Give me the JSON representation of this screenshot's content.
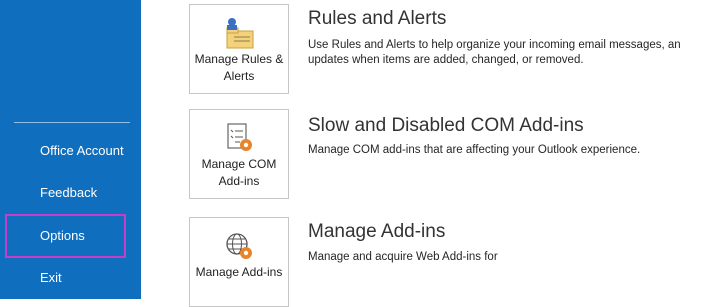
{
  "sidebar": {
    "items": [
      {
        "label": "Office Account"
      },
      {
        "label": "Feedback"
      },
      {
        "label": "Options"
      },
      {
        "label": "Exit"
      }
    ]
  },
  "sections": [
    {
      "button_label": "Manage Rules & Alerts",
      "icon": "rules-alerts-icon",
      "title": "Rules and Alerts",
      "desc_line1": "Use Rules and Alerts to help organize your incoming email messages, an",
      "desc_line2": "updates when items are added, changed, or removed."
    },
    {
      "button_label": "Manage COM Add-ins",
      "icon": "com-addins-icon",
      "title": "Slow and Disabled COM Add-ins",
      "desc_line1": "Manage COM add-ins that are affecting your Outlook experience."
    },
    {
      "button_label": "Manage Add-ins",
      "icon": "globe-gear-icon",
      "title": "Manage Add-ins",
      "desc_line1": "Manage and acquire Web Add-ins for"
    }
  ],
  "colors": {
    "sidebar": "#106ebe",
    "highlight": "#c83dc8",
    "gear": "#e8842a"
  }
}
